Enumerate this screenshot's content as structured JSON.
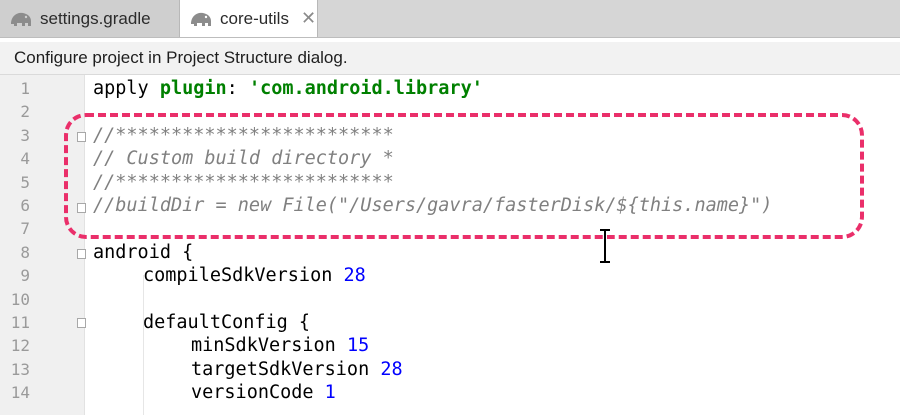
{
  "tabs": [
    {
      "label": "settings.gradle",
      "icon": "gradle-elephant-icon",
      "active": false
    },
    {
      "label": "core-utils",
      "icon": "gradle-elephant-icon",
      "active": true,
      "close": "✕"
    }
  ],
  "banner": {
    "text": "Configure project in Project Structure dialog."
  },
  "editor": {
    "line_numbers": [
      "1",
      "2",
      "3",
      "4",
      "5",
      "6",
      "7",
      "8",
      "9",
      "10",
      "11",
      "12",
      "13",
      "14"
    ],
    "l1": {
      "kw": "apply",
      "plugin": "plugin",
      "colon": ":",
      "str": "'com.android.library'"
    },
    "l3": "//*************************",
    "l4": "// Custom build directory *",
    "l5": "//*************************",
    "l6": "//buildDir = new File(\"/Users/gavra/fasterDisk/${this.name}\")",
    "l8": "android {",
    "l9": {
      "text": "compileSdkVersion",
      "num": "28"
    },
    "l11": "defaultConfig {",
    "l12": {
      "text": "minSdkVersion",
      "num": "15"
    },
    "l13": {
      "text": "targetSdkVersion",
      "num": "28"
    },
    "l14": {
      "text": "versionCode",
      "num": "1"
    }
  },
  "colors": {
    "annotation": "#ea2f6a",
    "comment": "#808080",
    "string": "#008000",
    "number": "#0000ff"
  }
}
